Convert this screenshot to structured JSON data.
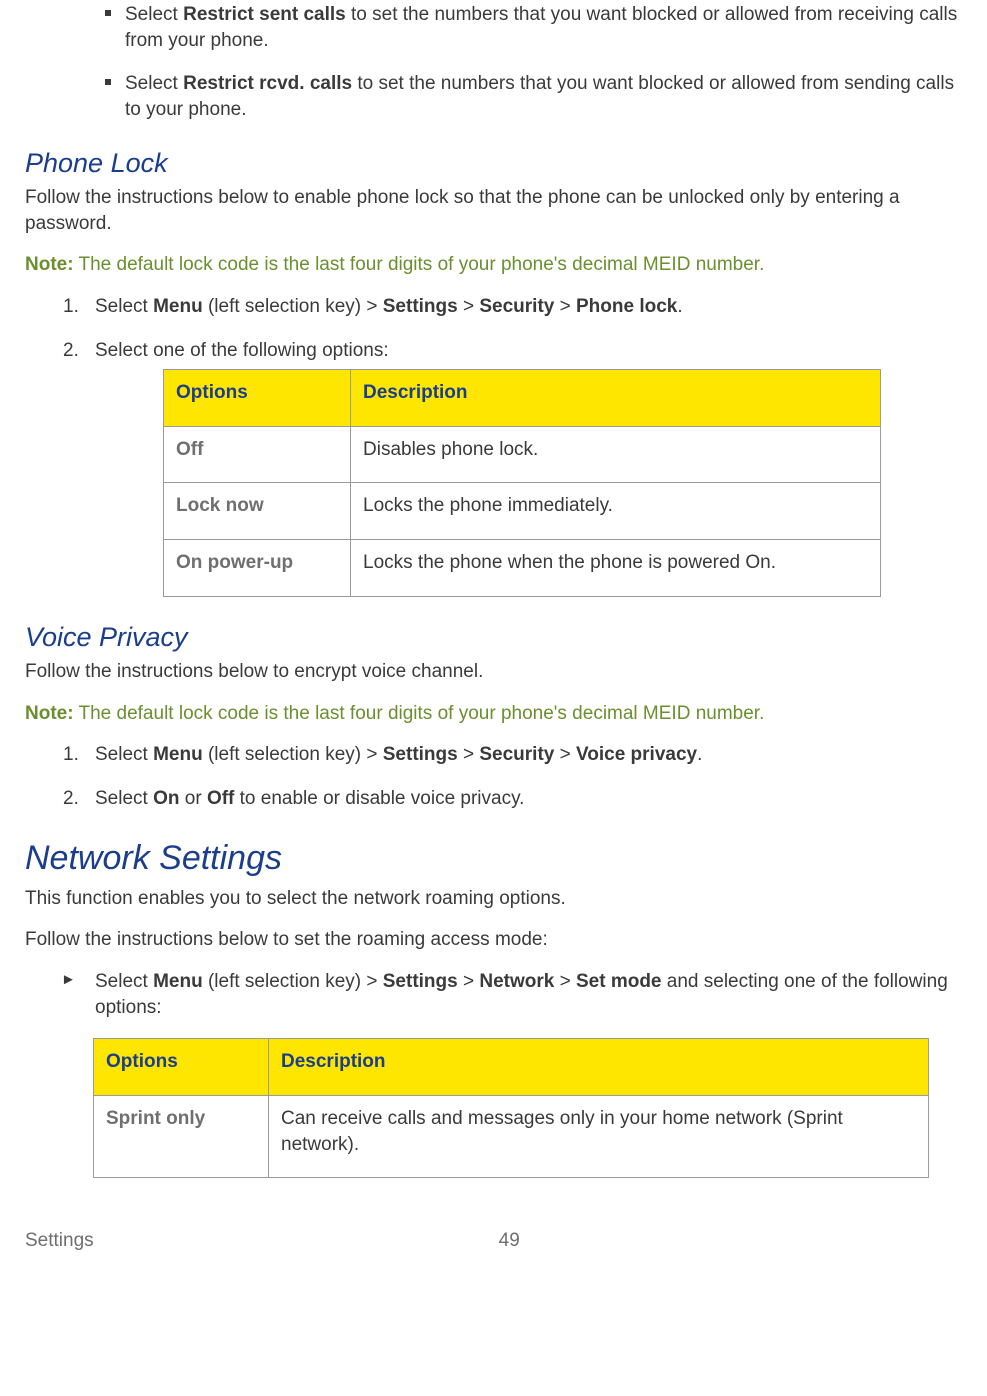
{
  "restrict": {
    "sent": {
      "prefix": "Select ",
      "bold": "Restrict sent calls",
      "suffix": " to set the numbers that you want blocked or allowed from receiving calls from your phone."
    },
    "rcvd": {
      "prefix": "Select ",
      "bold": "Restrict rcvd. calls",
      "suffix": " to set the numbers that you want blocked or allowed from sending calls to your phone."
    }
  },
  "phoneLock": {
    "heading": "Phone Lock",
    "intro": "Follow the instructions below to enable phone lock so that  the phone can be unlocked only by entering a password.",
    "noteLabel": "Note:",
    "noteText": " The default lock code is the last four digits of your phone's decimal MEID number.",
    "step1": {
      "prefix": "Select ",
      "b1": "Menu",
      "mid1": " (left selection key) > ",
      "b2": "Settings",
      "mid2": " > ",
      "b3": "Security",
      "mid3": " > ",
      "b4": "Phone lock",
      "suffix": "."
    },
    "step2": "Select one of the following options:",
    "table": {
      "headers": {
        "options": "Options",
        "description": "Description"
      },
      "rows": [
        {
          "opt": "Off",
          "desc": "Disables phone lock."
        },
        {
          "opt": "Lock now",
          "desc": "Locks the phone immediately."
        },
        {
          "opt": "On power-up",
          "desc": "Locks the phone when the phone is powered On."
        }
      ]
    }
  },
  "voicePrivacy": {
    "heading": "Voice Privacy",
    "intro": "Follow the instructions below to encrypt voice channel.",
    "noteLabel": "Note:",
    "noteText": " The default lock code is the last four digits of your phone's decimal MEID number.",
    "step1": {
      "prefix": "Select ",
      "b1": "Menu",
      "mid1": " (left selection key) > ",
      "b2": "Settings",
      "mid2": " > ",
      "b3": "Security",
      "mid3": " > ",
      "b4": "Voice privacy",
      "suffix": "."
    },
    "step2": {
      "prefix": "Select ",
      "b1": "On",
      "mid": " or ",
      "b2": "Off",
      "suffix": " to enable or disable voice privacy."
    }
  },
  "network": {
    "heading": "Network Settings",
    "intro1": "This function enables you to select the network roaming options.",
    "intro2": "Follow the instructions below to set the roaming access mode:",
    "step": {
      "prefix": "Select ",
      "b1": "Menu",
      "mid1": " (left selection key) > ",
      "b2": "Settings",
      "mid2": " > ",
      "b3": "Network",
      "mid3": " > ",
      "b4": "Set mode",
      "suffix": " and selecting one of the following options:"
    },
    "table": {
      "headers": {
        "options": "Options",
        "description": "Description"
      },
      "rows": [
        {
          "opt": "Sprint only",
          "desc": "Can receive calls and messages only in your home network (Sprint network)."
        }
      ]
    }
  },
  "footer": {
    "section": "Settings",
    "page": "49"
  }
}
